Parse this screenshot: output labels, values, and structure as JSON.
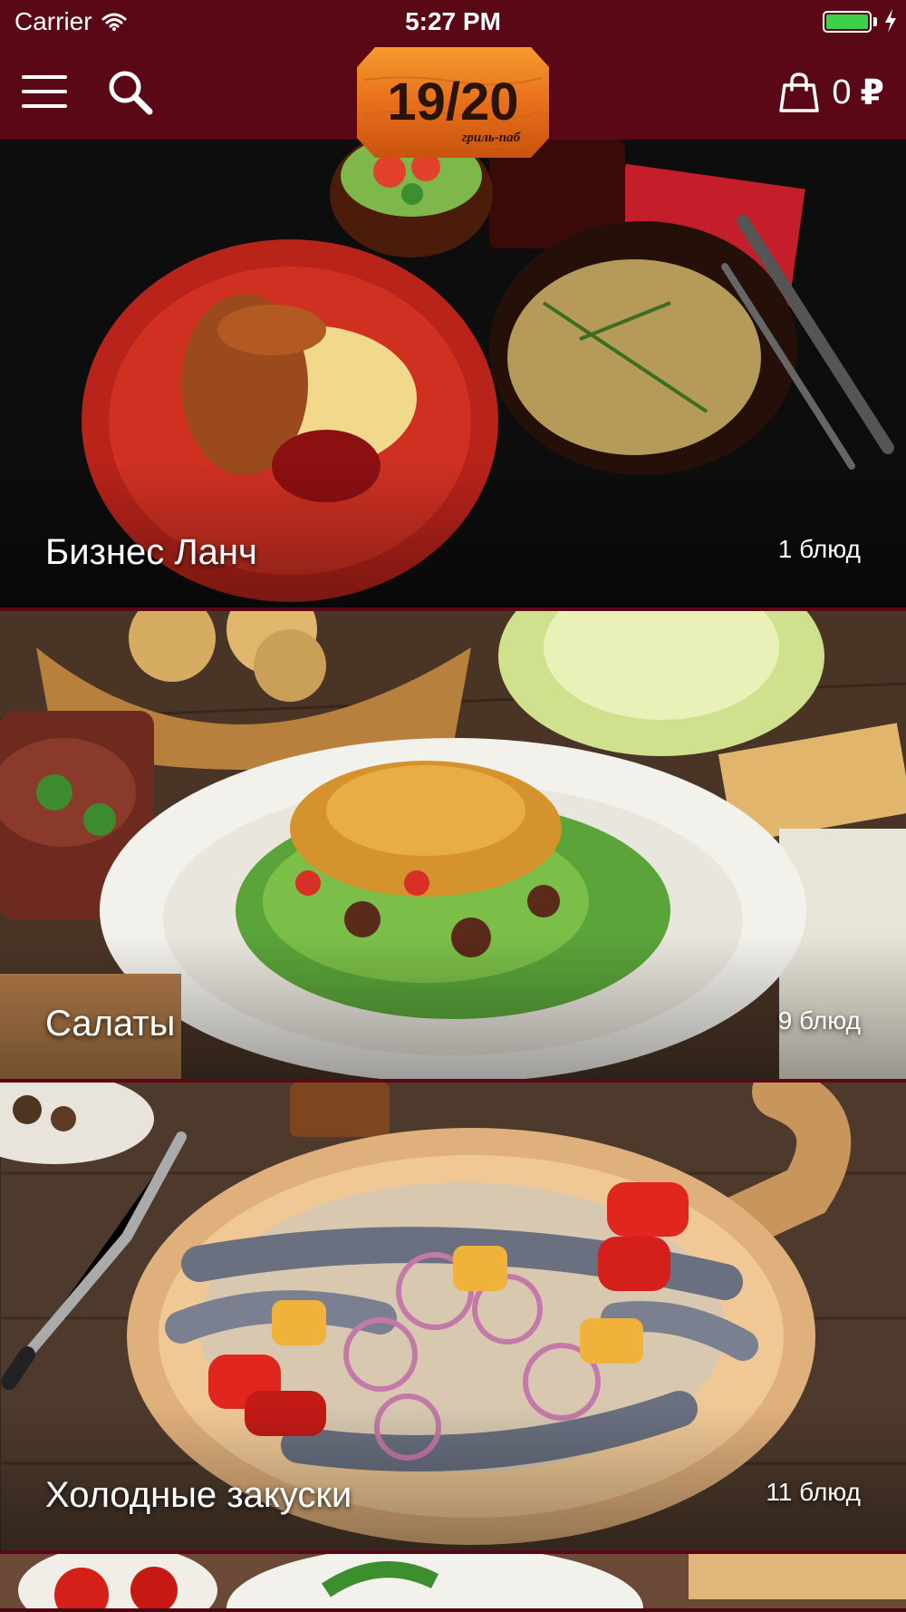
{
  "status_bar": {
    "carrier": "Carrier",
    "time": "5:27 PM",
    "battery_level": 1.0,
    "battery_color": "#3ed04a",
    "wifi_icon": "wifi-icon",
    "charging_icon": "bolt-icon"
  },
  "nav": {
    "menu_icon": "hamburger-icon",
    "search_icon": "search-icon",
    "logo": {
      "main_text": "19/20",
      "subtitle": "гриль-паб"
    },
    "cart": {
      "icon": "shopping-bag-icon",
      "count": "0",
      "currency": "₽"
    }
  },
  "colors": {
    "brand": "#5a0716",
    "logo_orange": "#e8701c",
    "text": "#ffffff"
  },
  "categories": [
    {
      "title": "Бизнес Ланч",
      "count": "1 блюд"
    },
    {
      "title": "Салаты",
      "count": "9 блюд"
    },
    {
      "title": "Холодные закуски",
      "count": "11 блюд"
    },
    {
      "title": "",
      "count": ""
    }
  ]
}
